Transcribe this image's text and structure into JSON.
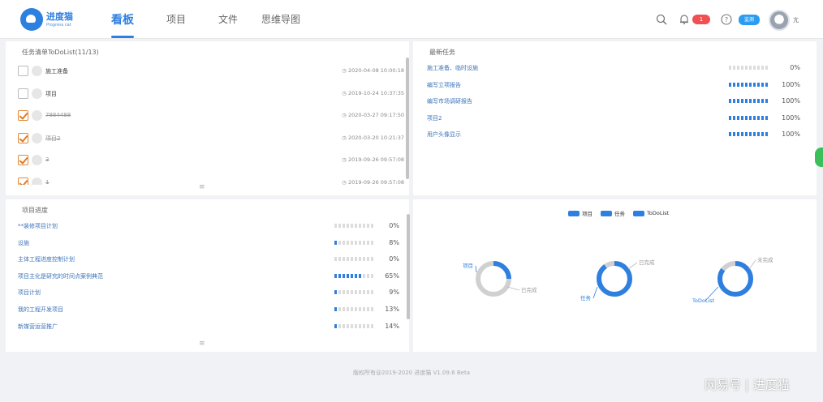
{
  "header": {
    "logo_text": "进度猫",
    "logo_sub": "Progress cat",
    "nav": [
      "看板",
      "项目",
      "文件",
      "思维导图"
    ],
    "notification_count": "1",
    "status_pill": "监测",
    "user_name": "亢"
  },
  "todo": {
    "title": "任务清单ToDoList(11/13)",
    "items": [
      {
        "label": "施工准备",
        "time": "2020-04-08 10:00:18",
        "done": false
      },
      {
        "label": "项目",
        "time": "2019-10-24 10:37:35",
        "done": false
      },
      {
        "label": "7884488",
        "time": "2020-03-27 09:17:50",
        "done": true
      },
      {
        "label": "项目2",
        "time": "2020-03-20 10:21:37",
        "done": true
      },
      {
        "label": "3",
        "time": "2019-09-26 09:57:08",
        "done": true
      },
      {
        "label": "1",
        "time": "2019-09-26 09:57:08",
        "done": true
      }
    ]
  },
  "latest": {
    "title": "最新任务",
    "items": [
      {
        "label": "施工准备、临时设施",
        "pct": 0,
        "pct_text": "0%"
      },
      {
        "label": "编写立项报告",
        "pct": 100,
        "pct_text": "100%"
      },
      {
        "label": "编写市场调研报告",
        "pct": 100,
        "pct_text": "100%"
      },
      {
        "label": "项目2",
        "pct": 100,
        "pct_text": "100%"
      },
      {
        "label": "用户头像显示",
        "pct": 100,
        "pct_text": "100%"
      }
    ]
  },
  "progress": {
    "title": "项目进度",
    "items": [
      {
        "label": "**装修项目计划",
        "pct": 0,
        "pct_text": "0%"
      },
      {
        "label": "设施",
        "pct": 8,
        "pct_text": "8%"
      },
      {
        "label": "主体工程进度控制计划",
        "pct": 0,
        "pct_text": "0%"
      },
      {
        "label": "项目主化是研究的时间点案例典范",
        "pct": 65,
        "pct_text": "65%"
      },
      {
        "label": "项目计划",
        "pct": 9,
        "pct_text": "9%"
      },
      {
        "label": "我的工程开发项目",
        "pct": 13,
        "pct_text": "13%"
      },
      {
        "label": "新媒营运营推广",
        "pct": 14,
        "pct_text": "14%"
      }
    ]
  },
  "chart_data": {
    "type": "pie",
    "legend": [
      "项目",
      "任务",
      "ToDoList"
    ],
    "legend_position": "top-center",
    "series": [
      {
        "name": "项目",
        "done_label": "项目",
        "rest_label": "已完成",
        "done_fraction": 0.25
      },
      {
        "name": "任务",
        "done_label": "任务",
        "rest_label": "已完成",
        "done_fraction": 0.9
      },
      {
        "name": "ToDoList",
        "done_label": "ToDoList",
        "rest_label": "未完成",
        "done_fraction": 0.85
      }
    ],
    "colors": {
      "primary": "#2d7fe0",
      "rest": "#d0d0d0"
    }
  },
  "footer": {
    "copyright": "版权所有@2019-2020 进度猫 V1.09.6 Beta"
  },
  "watermark": "网易号 | 进度猫"
}
